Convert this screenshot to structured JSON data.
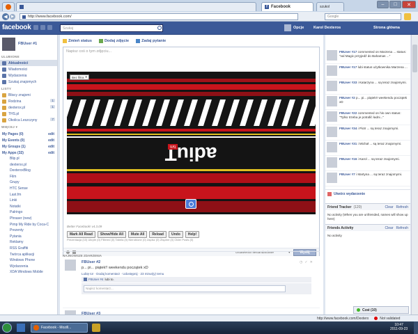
{
  "browser": {
    "active_tab": "Facebook",
    "inactive_tab_label": "szukol",
    "address": "http://www.facebook.com/",
    "search_placeholder": "Google",
    "minimize": "–",
    "maximize": "□",
    "close": "✕"
  },
  "fbbar": {
    "logo": "facebook",
    "search_placeholder": "Szukaj",
    "options": "Opcje",
    "user_name": "Karol Dexteros",
    "home_link": "Strona główna"
  },
  "left": {
    "profile_name": "FBUser #1",
    "favorites_title": "ULUBIONE",
    "favorites": [
      {
        "label": "Aktualności",
        "count": ""
      },
      {
        "label": "Wiadomości",
        "count": ""
      },
      {
        "label": "Wydarzenia",
        "count": ""
      },
      {
        "label": "Szukaj znajomych",
        "count": ""
      }
    ],
    "pages_title": "LISTY",
    "pages": [
      {
        "label": "Bliscy znajomi",
        "count": ""
      },
      {
        "label": "Rodzina",
        "count": "1"
      },
      {
        "label": "dexterxx.pl",
        "count": "1"
      },
      {
        "label": "THS.pl",
        "count": ""
      },
      {
        "label": "Okolica Leszczyny",
        "count": "7"
      }
    ],
    "more_title": "WIĘCEJ ▾",
    "sections": [
      {
        "label": "My Pages (0)",
        "edit": "edit"
      },
      {
        "label": "My Events (0)",
        "edit": "edit"
      },
      {
        "label": "My Groups (1)",
        "edit": "edit"
      },
      {
        "label": "My Apps (32)",
        "edit": "edit"
      }
    ],
    "apps": [
      "Blip.pl",
      "dexterxx.pl",
      "DexterxxBlog",
      "Film",
      "Grupy",
      "HTC Sense",
      "Last.fm",
      "Linki",
      "Notatki",
      "Palringo",
      "Phraser (new)",
      "Pimp My Ride by Coca-C",
      "Prezenty",
      "Pytania",
      "Reklamy",
      "RSS Graffiti",
      "Twórca aplikacji",
      "Windows Phone",
      "Wydarzenia",
      "XDA Windows Mobile"
    ]
  },
  "composer": {
    "tab_status": "Zmień status",
    "tab_photo": "Dodaj zdjęcie",
    "tab_question": "Zadaj pytanie",
    "placeholder": "Napisz coś o tym zdjęciu...",
    "filter_label": "Bez filtra",
    "privacy": "Ustawienia niestandardowe",
    "submit": "Wyślij"
  },
  "photo": {
    "logo_text": "adiuT",
    "logo_badge": "tvn",
    "colors": {
      "stripe_red": "#c8141c",
      "dark": "#1a1a1a",
      "white": "#ffffff"
    }
  },
  "better": {
    "header": "Better Facebook! v4.3.09",
    "buttons": [
      "Mark All Read",
      "Show/Hide All",
      "Mute All",
      "Reload",
      "Undo",
      "Help!"
    ],
    "legend": "Prezentacja (10) Ukryte (0) Filtered (0) Tabela (0) Nierobione (0) Zapisz (0) Zbędne (0) Older Posts (0)"
  },
  "feed": {
    "title": "NAJNOWSZE ZDARZENIA",
    "post": {
      "author": "FBUser #2",
      "text": "p... pi... piątek!! weekendu początek xD",
      "actions": "Lubię to! · Dodaj komentarz · Udostępnij · 23 minut(y) temu",
      "likes_author": "FBUser #4",
      "likes_suffix": "lubi to.",
      "comment_placeholder": "Napisz komentarz..."
    },
    "second_author": "FBUser #3"
  },
  "right": {
    "notifications": [
      {
        "user": "FBUser #17",
        "text": "commented on Marzena ... status: \"val Magic przyjedź do Bahamas ...\""
      },
      {
        "user": "FBUser #17",
        "text": "lubi status użytkownika Marzena ..."
      },
      {
        "user": "FBUser #33",
        "text": "i Katarzyna ... są teraz znajomymi."
      },
      {
        "user": "FBUser #2",
        "text": "p... pi... piątek!! weekendu początek xD"
      },
      {
        "user": "FBUser #22",
        "text": "commented on his own status: \"Tylko trzeba je potrafić ładni...\""
      },
      {
        "user": "FBUser #34",
        "text": "i Piotr ... są teraz znajomymi."
      },
      {
        "user": "FBUser #31",
        "text": "i Michał ... są teraz znajomymi."
      },
      {
        "user": "FBUser #16",
        "text": "i Karol ... są teraz znajomymi."
      },
      {
        "user": "FBUser #7",
        "text": "i Martyna ... są teraz znajomymi."
      }
    ],
    "create_event": "Utwórz wydarzenie",
    "tracker_title": "Friend Tracker",
    "tracker_count": "(120)",
    "clear": "Clear",
    "refresh": "Refresh",
    "tracker_text": "No activity (When you are unfriended, names will show up here)",
    "activity_title": "Friends Activity",
    "activity_text": "No activity",
    "chat": "Czat (10)"
  },
  "statusbar": {
    "url": "http://www.facebook.com/Dexterx",
    "validation": "Not validated",
    "time": "10:47",
    "date": "2011-09-23",
    "taskbar_app": "Facebook - Mozill..."
  }
}
